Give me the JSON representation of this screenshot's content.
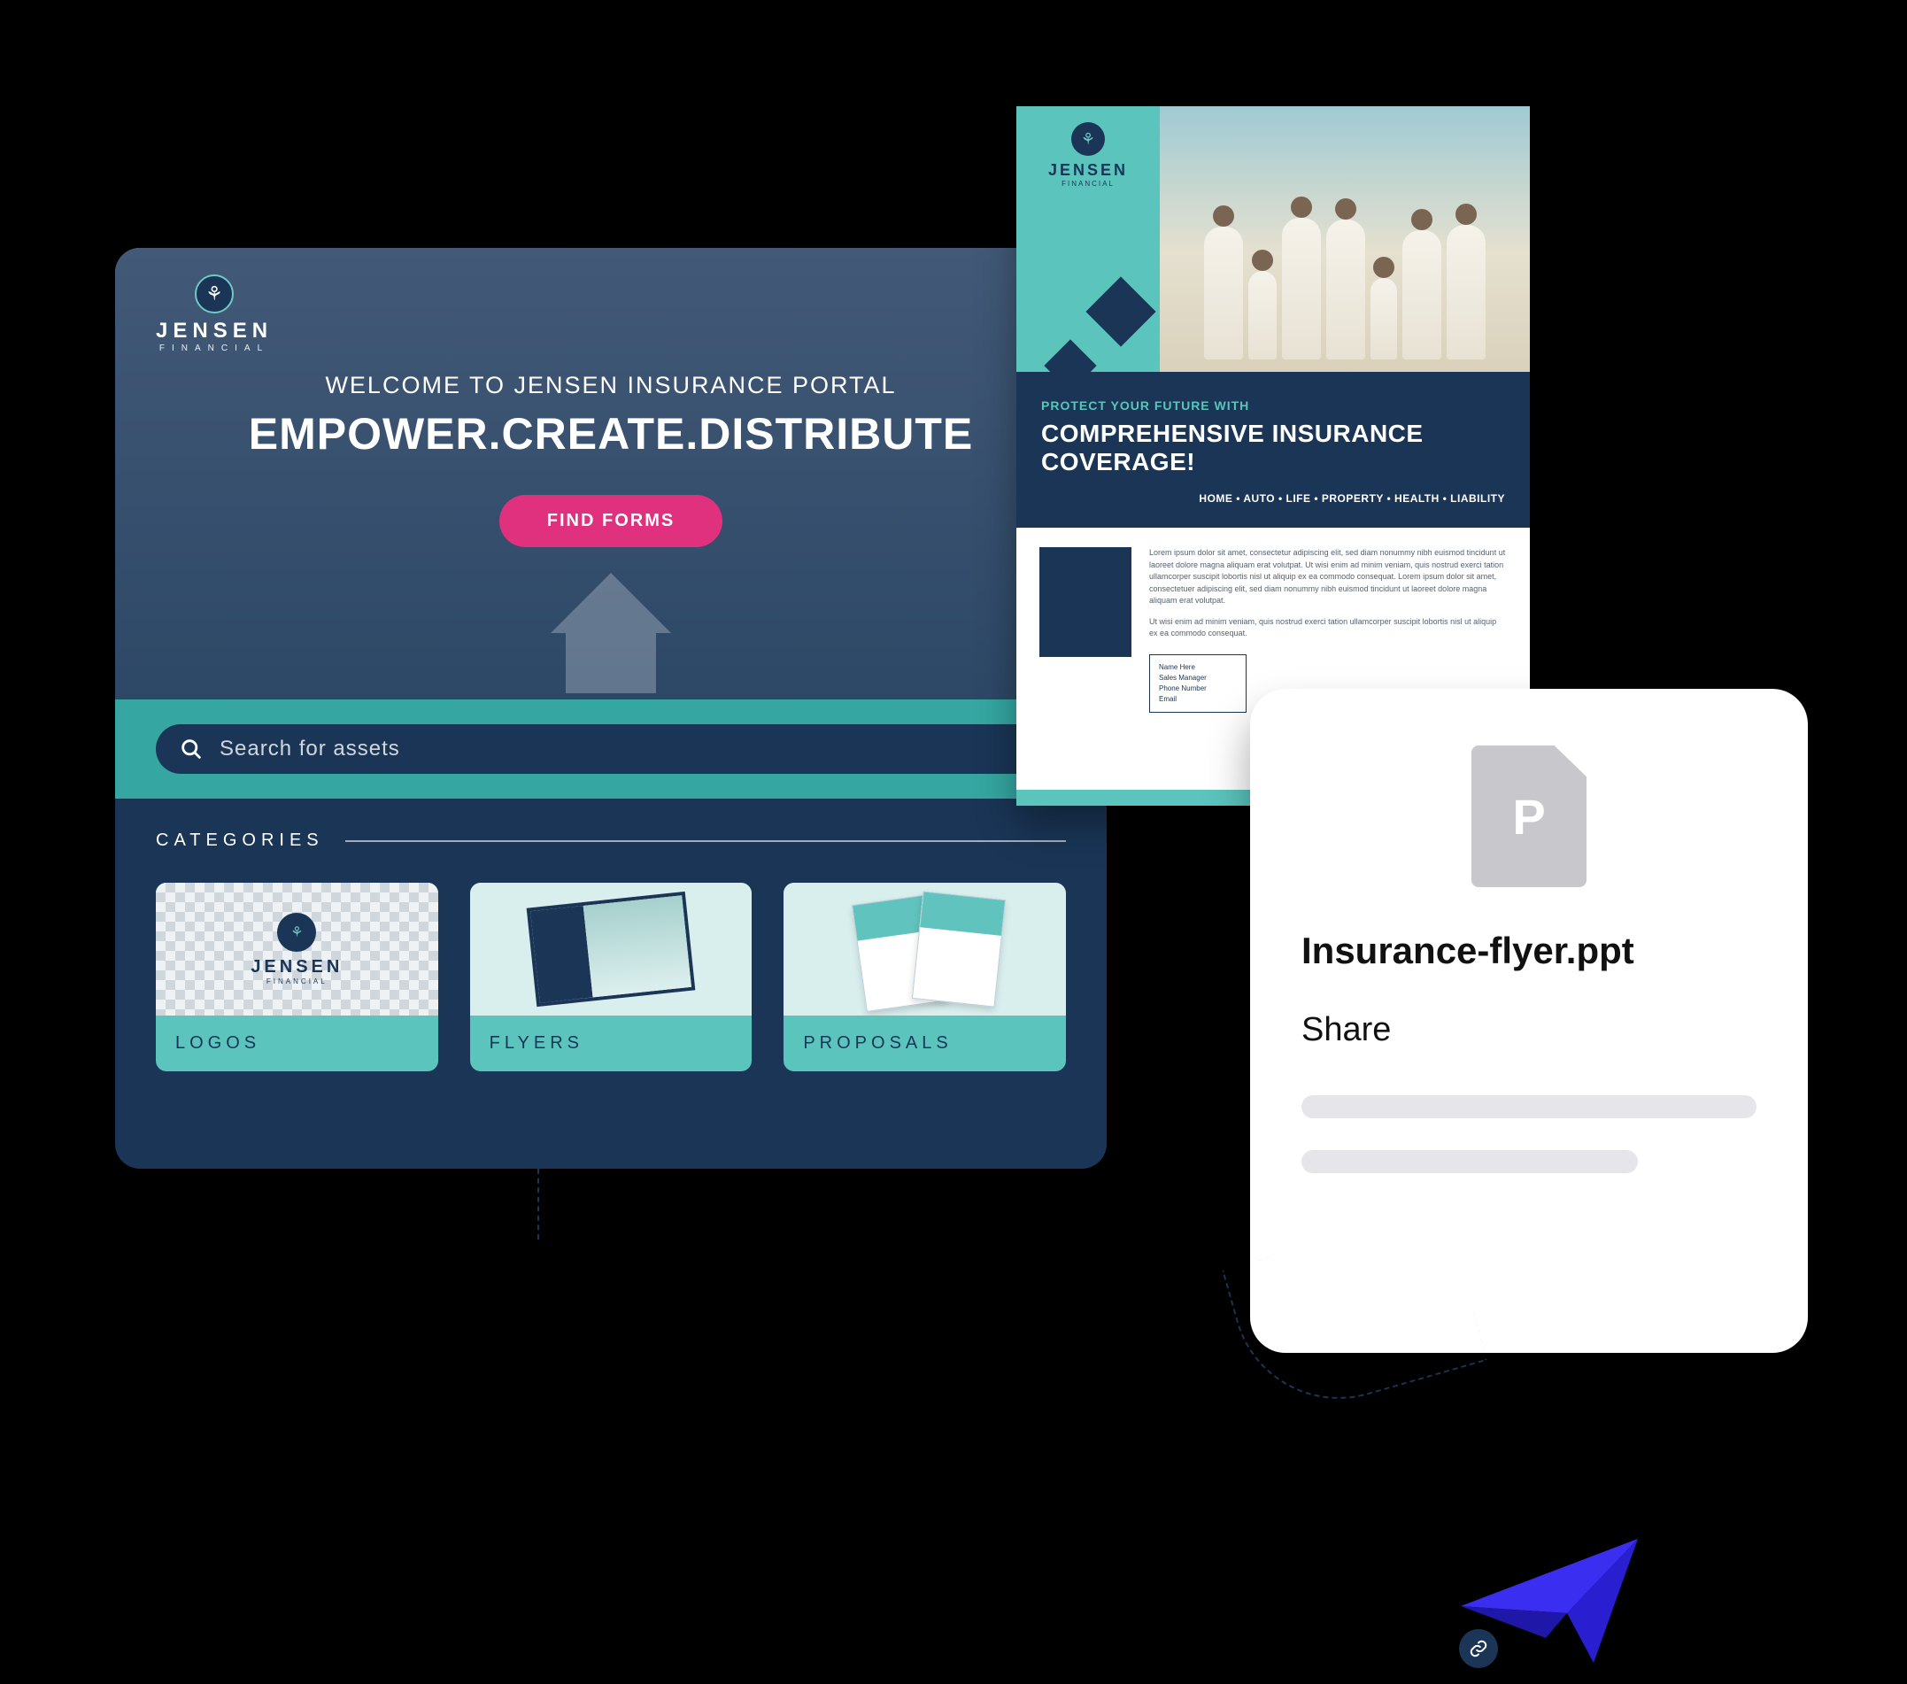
{
  "brand": {
    "name": "JENSEN",
    "sub": "FINANCIAL",
    "logo_glyph": "⚘"
  },
  "portal": {
    "welcome": "WELCOME TO JENSEN INSURANCE PORTAL",
    "tagline": "EMPOWER.CREATE.DISTRIBUTE",
    "cta_label": "FIND FORMS",
    "search_placeholder": "Search for assets",
    "categories_heading": "CATEGORIES",
    "categories": [
      {
        "label": "LOGOS"
      },
      {
        "label": "FLYERS"
      },
      {
        "label": "PROPOSALS"
      }
    ]
  },
  "flyer": {
    "pretitle": "PROTECT YOUR FUTURE WITH",
    "title": "COMPREHENSIVE INSURANCE COVERAGE!",
    "cat_line": "HOME • AUTO • LIFE • PROPERTY • HEALTH • LIABILITY",
    "para1": "Lorem ipsum dolor sit amet, consectetur adipiscing elit, sed diam nonummy nibh euismod tincidunt ut laoreet dolore magna aliquam erat volutpat. Ut wisi enim ad minim veniam, quis nostrud exerci tation ullamcorper suscipit lobortis nisl ut aliquip ex ea commodo consequat. Lorem ipsum dolor sit amet, consectetuer adipiscing elit, sed diam nonummy nibh euismod tincidunt ut laoreet dolore magna aliquam erat volutpat.",
    "para2": "Ut wisi enim ad minim veniam, quis nostrud exerci tation ullamcorper suscipit lobortis nisl ut aliquip ex ea commodo consequat.",
    "contact": {
      "name_label": "Name Here",
      "role": "Sales Manager",
      "phone_label": "Phone Number",
      "email_label": "Email"
    }
  },
  "file_card": {
    "icon_letter": "P",
    "file_name": "Insurance-flyer.ppt",
    "share_label": "Share"
  }
}
